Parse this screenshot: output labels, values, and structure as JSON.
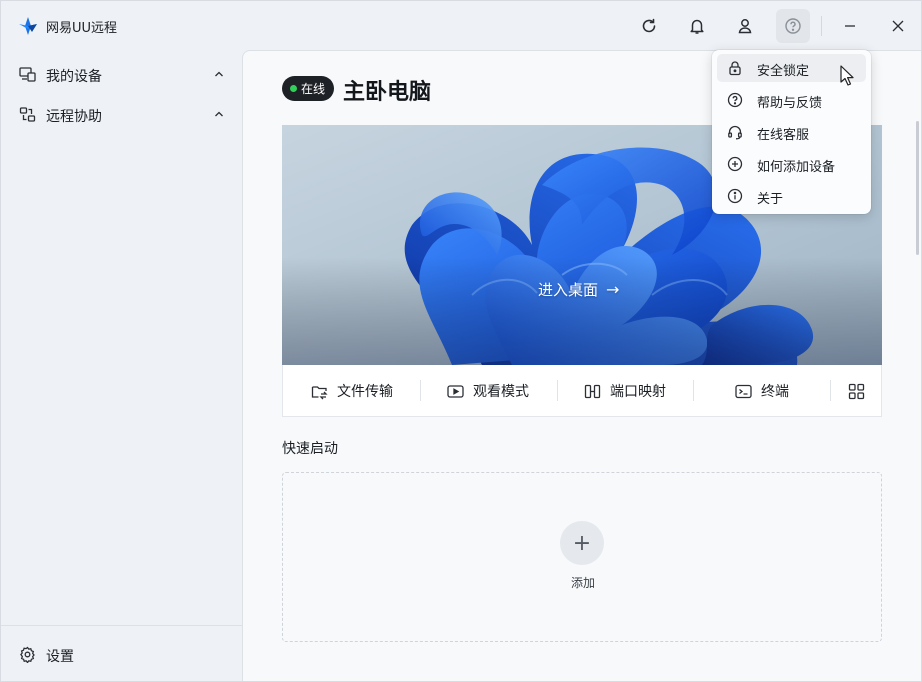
{
  "app": {
    "title": "网易UU远程",
    "accent": "#1677ff"
  },
  "titlebar": {
    "buttons": [
      {
        "icon": "refresh-icon"
      },
      {
        "icon": "bell-icon"
      },
      {
        "icon": "user-icon"
      },
      {
        "icon": "help-icon"
      },
      {
        "icon": "minimize-icon"
      },
      {
        "icon": "close-icon"
      }
    ]
  },
  "sidebar": {
    "items": [
      {
        "label": "我的设备",
        "icon": "devices-icon"
      },
      {
        "label": "远程协助",
        "icon": "remote-assist-icon"
      }
    ],
    "settings": {
      "label": "设置",
      "icon": "gear-icon"
    }
  },
  "device": {
    "status": "在线",
    "status_color": "#2fd158",
    "name": "主卧电脑",
    "enter_label": "进入桌面"
  },
  "actions": [
    {
      "label": "文件传输",
      "icon": "file-transfer-icon"
    },
    {
      "label": "观看模式",
      "icon": "watch-mode-icon"
    },
    {
      "label": "端口映射",
      "icon": "port-mapping-icon"
    },
    {
      "label": "终端",
      "icon": "terminal-icon"
    },
    {
      "label": "",
      "icon": "grid-icon"
    }
  ],
  "quick_launch": {
    "title": "快速启动",
    "add_label": "添加"
  },
  "menu": {
    "items": [
      {
        "label": "安全锁定",
        "icon": "lock-icon"
      },
      {
        "label": "帮助与反馈",
        "icon": "help-circle-icon"
      },
      {
        "label": "在线客服",
        "icon": "headset-icon"
      },
      {
        "label": "如何添加设备",
        "icon": "plus-circle-icon"
      },
      {
        "label": "关于",
        "icon": "info-icon"
      }
    ]
  }
}
